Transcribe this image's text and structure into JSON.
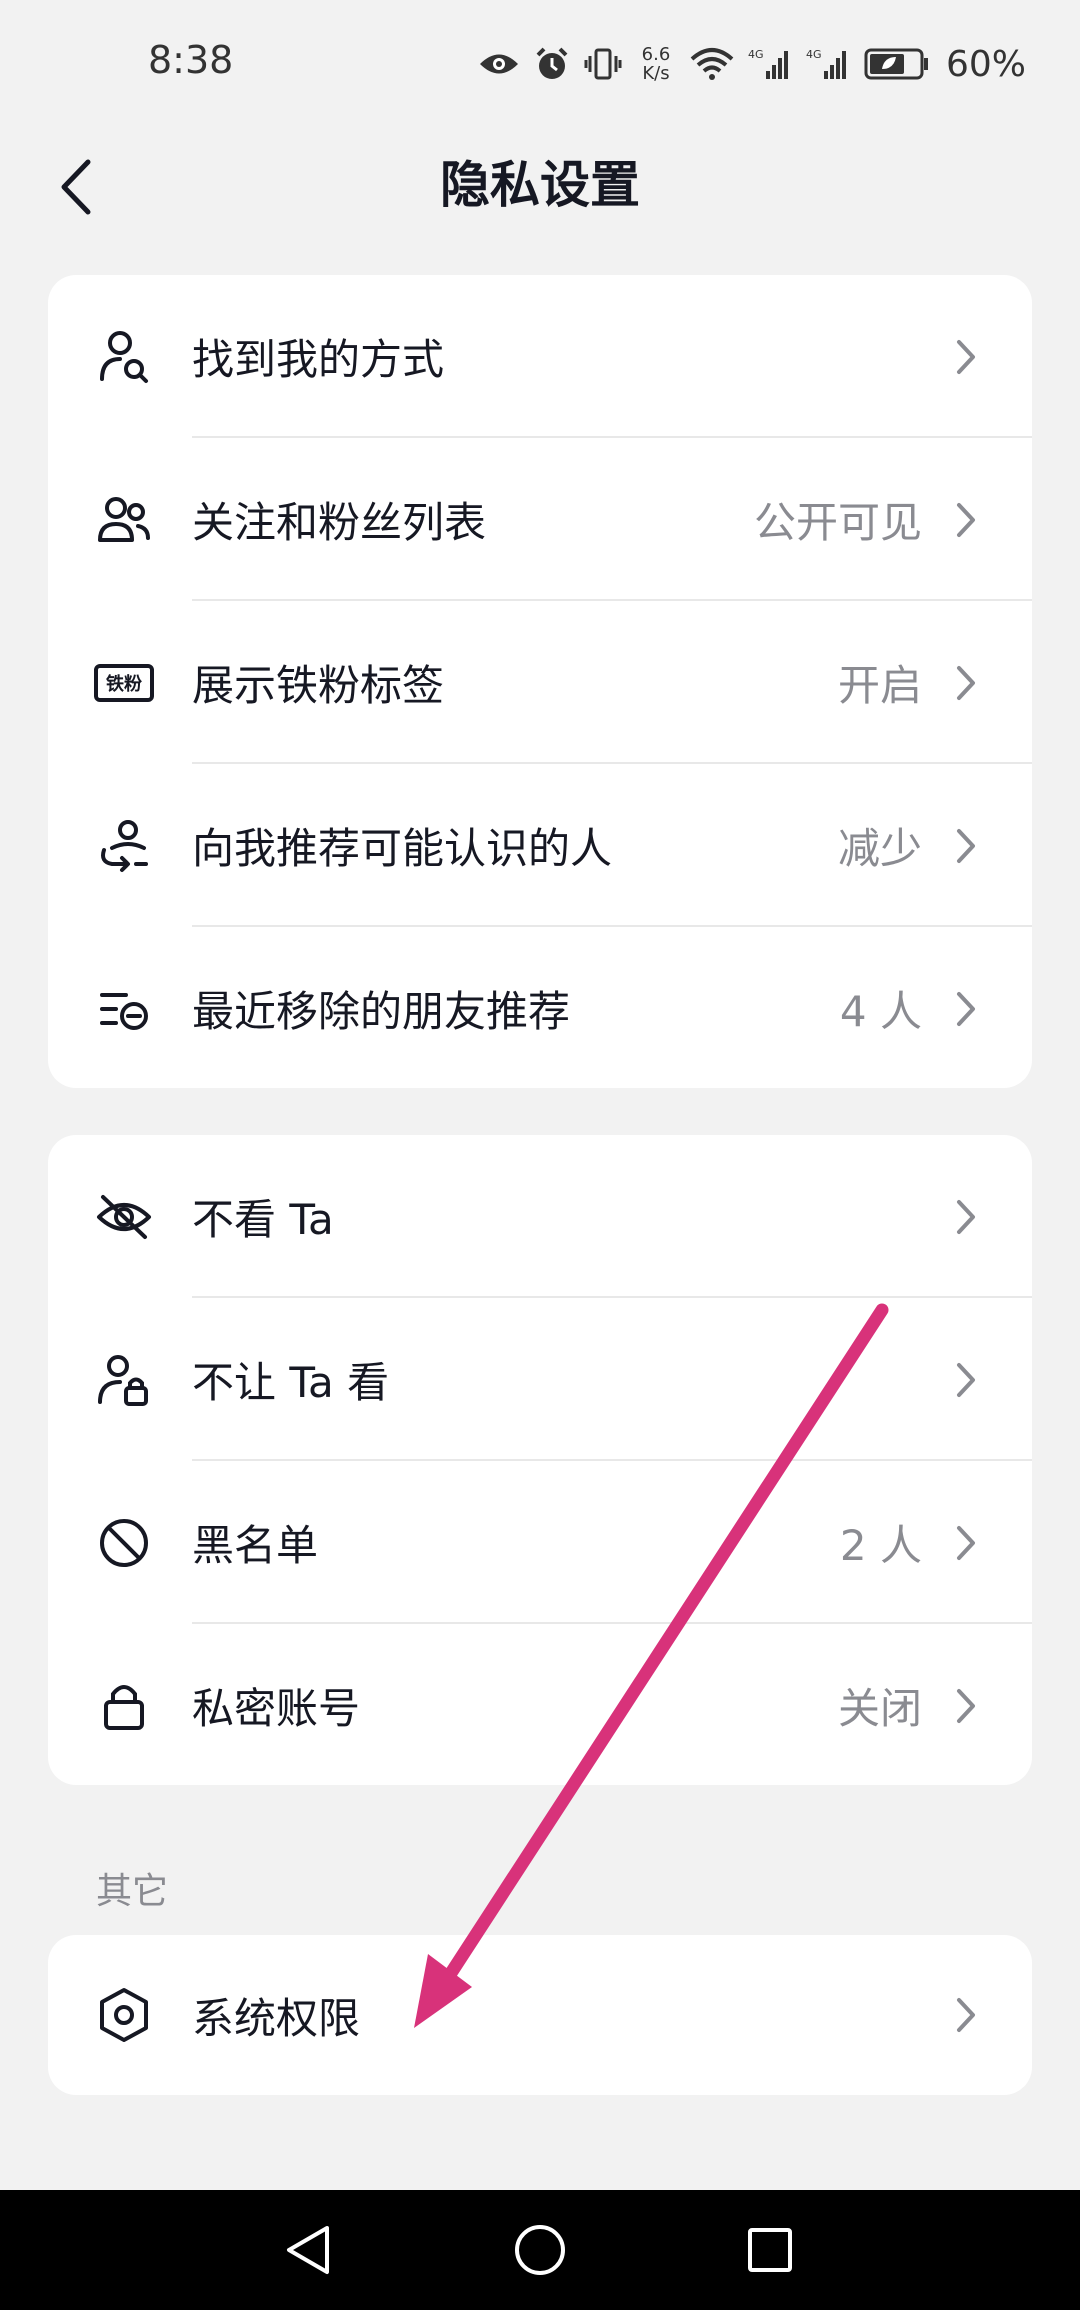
{
  "status_bar": {
    "time": "8:38",
    "speed_value": "6.6",
    "speed_unit": "K/s",
    "net1": "4G",
    "net2": "4G",
    "battery": "60%"
  },
  "header": {
    "title": "隐私设置"
  },
  "group1": [
    {
      "label": "找到我的方式",
      "value": "",
      "icon": "find-user-icon"
    },
    {
      "label": "关注和粉丝列表",
      "value": "公开可见",
      "icon": "followers-icon"
    },
    {
      "label": "展示铁粉标签",
      "value": "开启",
      "icon": "iron-fan-badge-icon",
      "badge_text": "铁粉"
    },
    {
      "label": "向我推荐可能认识的人",
      "value": "减少",
      "icon": "recommend-people-icon"
    },
    {
      "label": "最近移除的朋友推荐",
      "value": "4 人",
      "icon": "removed-list-icon"
    }
  ],
  "group2": [
    {
      "label": "不看 Ta",
      "value": "",
      "icon": "eye-off-icon"
    },
    {
      "label": "不让 Ta 看",
      "value": "",
      "icon": "user-lock-icon"
    },
    {
      "label": "黑名单",
      "value": "2 人",
      "icon": "block-icon"
    },
    {
      "label": "私密账号",
      "value": "关闭",
      "icon": "lock-icon"
    }
  ],
  "section_other": {
    "label": "其它"
  },
  "group3": [
    {
      "label": "系统权限",
      "value": "",
      "icon": "hexagon-settings-icon"
    }
  ],
  "annotation": {
    "arrow_color": "#d8327a"
  },
  "system_nav": {
    "back": "back-triangle-icon",
    "home": "home-circle-icon",
    "recents": "recents-square-icon"
  }
}
